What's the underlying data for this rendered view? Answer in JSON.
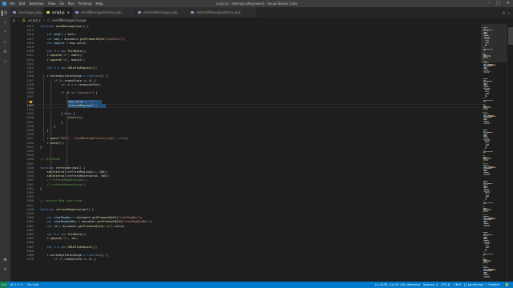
{
  "titlebar": {
    "menu": [
      "File",
      "Edit",
      "Selection",
      "View",
      "Go",
      "Run",
      "Terminal",
      "Help"
    ],
    "window_title": "script.js - ",
    "window_title_suffix": "sitemap-allegrowest - Visual Studio Code"
  },
  "tabs": [
    {
      "label": "messages.php",
      "active": false
    },
    {
      "label": "script.js",
      "active": true
    },
    {
      "label": "sendMessageActions.php",
      "active": false
    },
    {
      "label": "refreshMessages.php",
      "active": false
    },
    {
      "label": "refreshMessagesAction.php",
      "active": false
    }
  ],
  "breadcrumb": [
    "js",
    "script.js",
    "sendMessageChange"
  ],
  "editor": {
    "accent": "#007acc",
    "selection_color": "#264f78",
    "lines": [
      {
        "n": "1014",
        "code": [
          [
            "k",
            "function "
          ],
          [
            "f",
            "sendMessage"
          ],
          [
            "p",
            "(mail) {"
          ]
        ]
      },
      {
        "n": "1015",
        "code": []
      },
      {
        "n": "1016",
        "code": [
          [
            "p",
            "    "
          ],
          [
            "k",
            "var "
          ],
          [
            "v",
            "email"
          ],
          [
            "p",
            " = mail;"
          ]
        ]
      },
      {
        "n": "1017",
        "code": [
          [
            "p",
            "    "
          ],
          [
            "k",
            "var "
          ],
          [
            "v",
            "msg"
          ],
          [
            "p",
            " = document."
          ],
          [
            "f",
            "getElementById"
          ],
          [
            "p",
            "("
          ],
          [
            "s",
            "\"msgText\""
          ],
          [
            "p",
            ");"
          ]
        ]
      },
      {
        "n": "1018",
        "code": [
          [
            "p",
            "    "
          ],
          [
            "k",
            "var "
          ],
          [
            "v",
            "msgtxt"
          ],
          [
            "p",
            " = msg.value;"
          ]
        ]
      },
      {
        "n": "1019",
        "code": []
      },
      {
        "n": "1020",
        "code": [
          [
            "p",
            "    "
          ],
          [
            "k",
            "var "
          ],
          [
            "v",
            "f"
          ],
          [
            "p",
            " = "
          ],
          [
            "k",
            "new "
          ],
          [
            "f",
            "FormData"
          ],
          [
            "p",
            "();"
          ]
        ]
      },
      {
        "n": "1021",
        "code": [
          [
            "p",
            "    f."
          ],
          [
            "f",
            "append"
          ],
          [
            "p",
            "("
          ],
          [
            "s",
            "\"e\""
          ],
          [
            "p",
            ", email);"
          ]
        ]
      },
      {
        "n": "1022",
        "code": [
          [
            "p",
            "    f."
          ],
          [
            "f",
            "append"
          ],
          [
            "p",
            "("
          ],
          [
            "s",
            "\"m\""
          ],
          [
            "p",
            ", msgtxt);"
          ]
        ]
      },
      {
        "n": "1023",
        "code": []
      },
      {
        "n": "1024",
        "code": [
          [
            "p",
            "    "
          ],
          [
            "k",
            "var "
          ],
          [
            "v",
            "r"
          ],
          [
            "p",
            " = "
          ],
          [
            "k",
            "new "
          ],
          [
            "f",
            "XMLHttpRequest"
          ],
          [
            "p",
            "();"
          ]
        ]
      },
      {
        "n": "1025",
        "code": []
      },
      {
        "n": "1026",
        "code": [
          [
            "p",
            "    r.onreadystatechange = "
          ],
          [
            "k",
            "function"
          ],
          [
            "p",
            "() {"
          ]
        ]
      },
      {
        "n": "1027",
        "code": [
          [
            "p",
            "        "
          ],
          [
            "cf",
            "if "
          ],
          [
            "p",
            "(r.readyState == "
          ],
          [
            "n",
            "4"
          ],
          [
            "p",
            ") {"
          ]
        ]
      },
      {
        "n": "1028",
        "code": [
          [
            "p",
            "            "
          ],
          [
            "k",
            "var "
          ],
          [
            "v",
            "t"
          ],
          [
            "p",
            " = r.responseText;"
          ]
        ]
      },
      {
        "n": "1029",
        "code": []
      },
      {
        "n": "1030",
        "code": [
          [
            "p",
            "            "
          ],
          [
            "cf",
            "if "
          ],
          [
            "p",
            "(t == "
          ],
          [
            "s",
            "\"success\""
          ],
          [
            "p",
            ") {"
          ]
        ]
      },
      {
        "n": "1031",
        "code": []
      },
      {
        "n": "1032",
        "code": [
          [
            "p",
            "                msg.value = "
          ],
          [
            "s",
            "\"\""
          ],
          [
            "p",
            ";"
          ]
        ]
      },
      {
        "n": "1033",
        "code": [
          [
            "p",
            "                "
          ],
          [
            "f",
            "refreshMsg"
          ],
          [
            "p",
            "(mail);"
          ]
        ]
      },
      {
        "n": "1034",
        "code": []
      },
      {
        "n": "1035",
        "code": [
          [
            "p",
            "            } "
          ],
          [
            "cf",
            "else "
          ],
          [
            "p",
            "{"
          ]
        ]
      },
      {
        "n": "1036",
        "code": [
          [
            "p",
            "                "
          ],
          [
            "f",
            "alert"
          ],
          [
            "p",
            "(t);"
          ]
        ]
      },
      {
        "n": "1037",
        "code": [
          [
            "p",
            "            }"
          ]
        ]
      },
      {
        "n": "1038",
        "code": [
          [
            "p",
            "        }"
          ]
        ]
      },
      {
        "n": "1039",
        "code": [
          [
            "p",
            "    }"
          ]
        ]
      },
      {
        "n": "1040",
        "code": []
      },
      {
        "n": "1041",
        "code": [
          [
            "p",
            "    r."
          ],
          [
            "f",
            "open"
          ],
          [
            "p",
            "("
          ],
          [
            "s",
            "\"POST\""
          ],
          [
            "p",
            ", "
          ],
          [
            "s",
            "\"sendMessageProcess.php\""
          ],
          [
            "p",
            ", "
          ],
          [
            "k",
            "true"
          ],
          [
            "p",
            ");"
          ]
        ]
      },
      {
        "n": "1042",
        "code": [
          [
            "p",
            "    r."
          ],
          [
            "f",
            "send"
          ],
          [
            "p",
            "(f);"
          ]
        ]
      },
      {
        "n": "1043",
        "code": [
          [
            "p",
            "}"
          ]
        ]
      },
      {
        "n": "1044",
        "code": []
      },
      {
        "n": "1045",
        "code": []
      },
      {
        "n": "1046",
        "code": [
          [
            "c",
            "// refresher"
          ]
        ]
      },
      {
        "n": "1047",
        "code": []
      },
      {
        "n": "1048",
        "code": [
          [
            "k",
            "function "
          ],
          [
            "f",
            "refresher"
          ],
          [
            "p",
            "(mail) {"
          ]
        ]
      },
      {
        "n": "1049",
        "code": [
          [
            "p",
            "    "
          ],
          [
            "f",
            "setInterval"
          ],
          [
            "p",
            "(refreshMsg(mail), "
          ],
          [
            "n",
            "500"
          ],
          [
            "p",
            ");"
          ]
        ]
      },
      {
        "n": "1050",
        "code": [
          [
            "p",
            "    "
          ],
          [
            "f",
            "setInterval"
          ],
          [
            "p",
            "(refreshRecentArea, "
          ],
          [
            "n",
            "500"
          ],
          [
            "p",
            ");"
          ]
        ]
      },
      {
        "n": "1051",
        "code": [
          [
            "c",
            "    // refreshMsgArea(mail);"
          ]
        ]
      },
      {
        "n": "1052",
        "code": [
          [
            "c",
            "    // refreshRecentArea();"
          ]
        ]
      },
      {
        "n": "1053",
        "code": [
          [
            "p",
            "}"
          ]
        ]
      },
      {
        "n": "1054",
        "code": []
      },
      {
        "n": "1055",
        "code": []
      },
      {
        "n": "1056",
        "code": [
          [
            "c",
            "// refresh Msg view area"
          ]
        ]
      },
      {
        "n": "1057",
        "code": []
      },
      {
        "n": "1058",
        "code": [
          [
            "k",
            "function "
          ],
          [
            "f",
            "refreshMsgArea"
          ],
          [
            "p",
            "(mail) {"
          ]
        ]
      },
      {
        "n": "1059",
        "code": []
      },
      {
        "n": "1060",
        "code": [
          [
            "p",
            "    "
          ],
          [
            "k",
            "var "
          ],
          [
            "v",
            "chatMsgBox"
          ],
          [
            "p",
            " = document."
          ],
          [
            "f",
            "getElementById"
          ],
          [
            "p",
            "("
          ],
          [
            "s",
            "\"chatMsgBox\""
          ],
          [
            "p",
            ");"
          ]
        ]
      },
      {
        "n": "1061",
        "code": [
          [
            "p",
            "    "
          ],
          [
            "k",
            "var "
          ],
          [
            "v",
            "chatMsgBoxBox"
          ],
          [
            "p",
            " = document."
          ],
          [
            "f",
            "getElementById"
          ],
          [
            "p",
            "("
          ],
          [
            "s",
            "\"chatMsgBoxBox\""
          ],
          [
            "p",
            ");"
          ]
        ]
      },
      {
        "n": "1062",
        "code": [
          [
            "p",
            "    "
          ],
          [
            "k",
            "var "
          ],
          [
            "v",
            "id"
          ],
          [
            "p",
            " = document."
          ],
          [
            "f",
            "getElementById"
          ],
          [
            "p",
            "("
          ],
          [
            "s",
            "\"id\""
          ],
          [
            "p",
            ").value;"
          ]
        ]
      },
      {
        "n": "1063",
        "code": []
      },
      {
        "n": "1064",
        "code": [
          [
            "p",
            "    "
          ],
          [
            "k",
            "var "
          ],
          [
            "v",
            "f"
          ],
          [
            "p",
            " = "
          ],
          [
            "k",
            "new "
          ],
          [
            "f",
            "FormData"
          ],
          [
            "p",
            "();"
          ]
        ]
      },
      {
        "n": "1065",
        "code": [
          [
            "p",
            "    f."
          ],
          [
            "f",
            "append"
          ],
          [
            "p",
            "("
          ],
          [
            "s",
            "\"e\""
          ],
          [
            "p",
            ", id);"
          ]
        ]
      },
      {
        "n": "1066",
        "code": []
      },
      {
        "n": "1067",
        "code": [
          [
            "p",
            "    "
          ],
          [
            "k",
            "var "
          ],
          [
            "v",
            "r"
          ],
          [
            "p",
            " = "
          ],
          [
            "k",
            "new "
          ],
          [
            "f",
            "XMLHttpRequest"
          ],
          [
            "p",
            "();"
          ]
        ]
      },
      {
        "n": "1068",
        "code": []
      },
      {
        "n": "1069",
        "code": [
          [
            "p",
            "    r.onreadystatechange = "
          ],
          [
            "k",
            "function"
          ],
          [
            "p",
            "() {"
          ]
        ]
      },
      {
        "n": "1070",
        "code": [
          [
            "p",
            "        "
          ],
          [
            "cf",
            "if "
          ],
          [
            "p",
            "(r.readyState == "
          ],
          [
            "n",
            "4"
          ],
          [
            "p",
            ") {"
          ]
        ]
      }
    ]
  },
  "statusbar": {
    "remote": "><",
    "problems": "⊗ 0  ⚠ 0",
    "live": "Go Live",
    "position": "Ln 1033, Col 33 (30 selected)",
    "spaces": "Spaces: 4",
    "encoding": "UTF-8",
    "eol": "CRLF",
    "language": "{} JavaScript",
    "prettier": "✓ Prettier",
    "bell": "🔔"
  }
}
